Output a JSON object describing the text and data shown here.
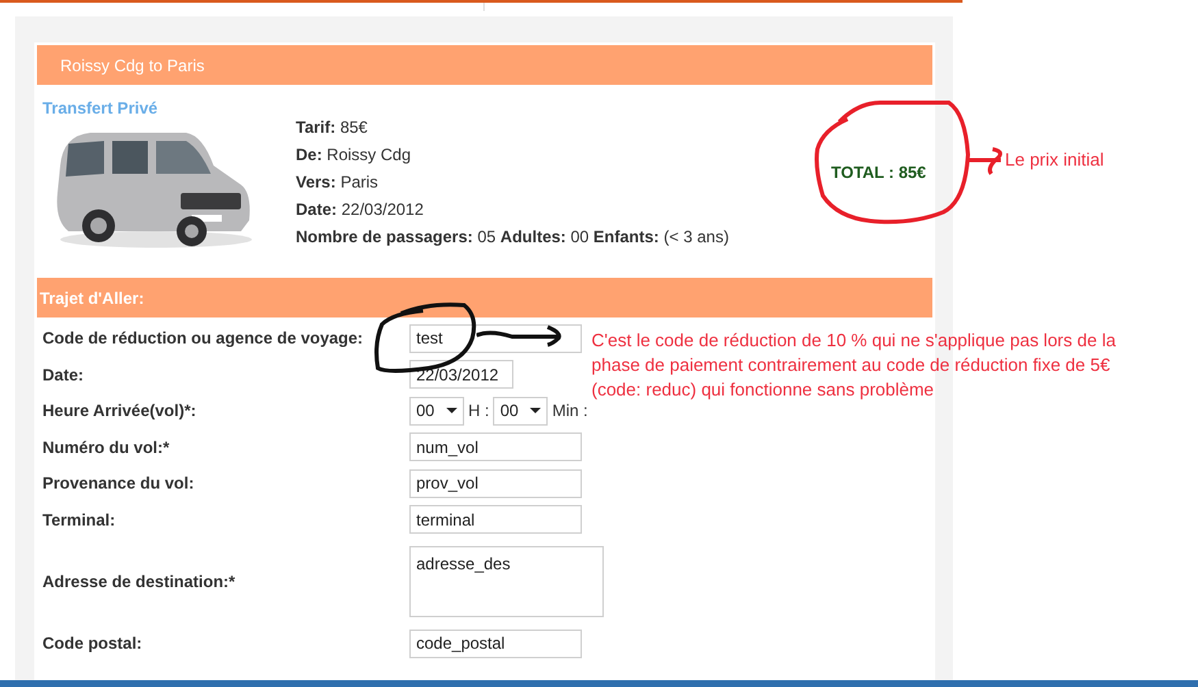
{
  "booking": {
    "title": "Roissy Cdg to Paris",
    "service": "Transfert Privé",
    "details": [
      "**Tarif:** 85€",
      "**De:** Roissy Cdg",
      "**Vers:** Paris",
      "**Date:** 22/03/2012",
      "**Nombre de passagers:** 05 **Adultes:** 00 **Enfants:** (< 3 ans)"
    ],
    "total": "TOTAL : 85€"
  },
  "section": {
    "title": "Trajet d'Aller:",
    "fields": [
      {
        "kind": "text",
        "label": "Code de réduction ou agence de voyage:",
        "value": "test"
      },
      {
        "kind": "date",
        "label": "Date:",
        "value": "22/03/2012"
      },
      {
        "kind": "time",
        "label": "Heure Arrivée(vol)*:",
        "hour": "00",
        "hour_unit": "H :",
        "minute": "00",
        "minute_unit": "Min :"
      },
      {
        "kind": "text",
        "label": "Numéro du vol:*",
        "value": "num_vol"
      },
      {
        "kind": "text",
        "label": "Provenance du vol:",
        "value": "prov_vol"
      },
      {
        "kind": "text",
        "label": "Terminal:",
        "value": "terminal"
      },
      {
        "kind": "textarea",
        "label": "Adresse de destination:*",
        "value": "adresse_des"
      },
      {
        "kind": "text",
        "label": "Code postal:",
        "value": "code_postal"
      }
    ]
  },
  "notes": {
    "price_note": "Le prix initial",
    "code_note": "C'est le code de réduction de 10 % qui ne s'applique pas lors de la phase de paiement contrairement au code de réduction fixe de 5€ (code:  reduc) qui fonctionne sans problème"
  }
}
